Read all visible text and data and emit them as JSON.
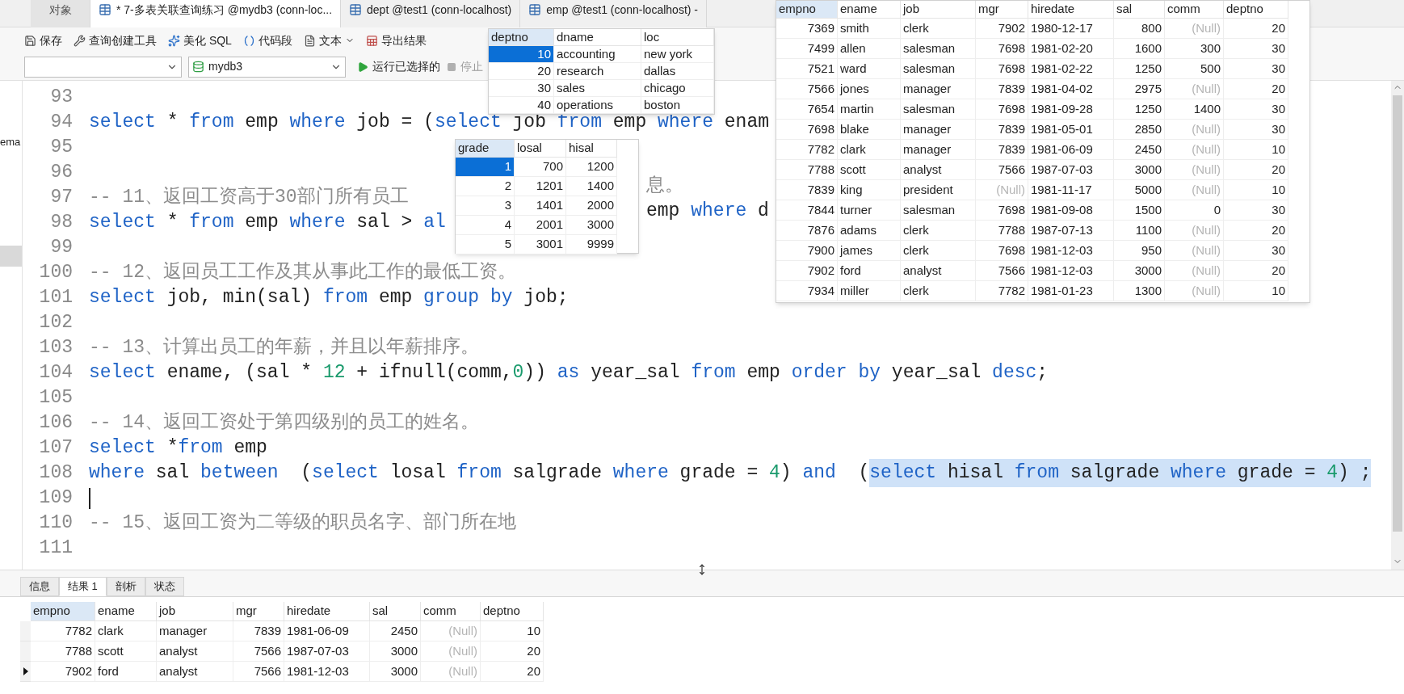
{
  "tabs": [
    {
      "label": "对象",
      "selected": false,
      "kind": "objects"
    },
    {
      "label": "* 7-多表关联查询练习 @mydb3 (conn-loc...",
      "selected": true,
      "kind": "query"
    },
    {
      "label": "dept @test1 (conn-localhost)",
      "selected": false,
      "kind": "table"
    },
    {
      "label": "emp @test1 (conn-localhost) -",
      "selected": false,
      "kind": "table"
    }
  ],
  "toolbar": [
    {
      "label": "保存",
      "kind": "save"
    },
    {
      "label": "查询创建工具",
      "kind": "builder"
    },
    {
      "label": "美化 SQL",
      "kind": "beautify"
    },
    {
      "label": "代码段",
      "kind": "snippet"
    },
    {
      "label": "文本",
      "kind": "text"
    },
    {
      "label": "导出结果",
      "kind": "export"
    }
  ],
  "run_bar": {
    "database": "mydb3",
    "run_button": "运行已选择的",
    "stop_button": {
      "label": "停止",
      "disabled": true
    }
  },
  "sidebar": {
    "text": "ema"
  },
  "editor": {
    "lines": [
      {
        "number": "93"
      },
      {
        "number": "94",
        "parts": [
          {
            "kind": "text",
            "selected": false,
            "tokens": [
              {
                "text": "select",
                "kind": "keyword"
              },
              {
                "text": " * ",
                "kind": "plain"
              },
              {
                "text": "from",
                "kind": "keyword"
              },
              {
                "text": " emp ",
                "kind": "plain"
              },
              {
                "text": "where",
                "kind": "keyword"
              },
              {
                "text": " job = (",
                "kind": "plain"
              },
              {
                "text": "select",
                "kind": "keyword"
              },
              {
                "text": " job ",
                "kind": "plain"
              },
              {
                "text": "from",
                "kind": "keyword"
              },
              {
                "text": " emp ",
                "kind": "plain"
              },
              {
                "text": "where",
                "kind": "keyword"
              },
              {
                "text": " enam",
                "kind": "plain"
              }
            ]
          }
        ]
      },
      {
        "number": "95"
      },
      {
        "number": "96"
      },
      {
        "number": "97",
        "parts": [
          {
            "kind": "text",
            "selected": false,
            "tokens": [
              {
                "text": "-- 11、返回工资高于30部门所有员工",
                "kind": "comment"
              }
            ]
          },
          {
            "kind": "covered"
          },
          {
            "kind": "text",
            "selected": false,
            "tokens": [
              {
                "text": "息。",
                "kind": "comment"
              }
            ]
          }
        ]
      },
      {
        "number": "98",
        "parts": [
          {
            "kind": "text",
            "selected": false,
            "tokens": [
              {
                "text": "select",
                "kind": "keyword"
              },
              {
                "text": " * ",
                "kind": "plain"
              },
              {
                "text": "from",
                "kind": "keyword"
              },
              {
                "text": " emp ",
                "kind": "plain"
              },
              {
                "text": "where",
                "kind": "keyword"
              },
              {
                "text": " sal > ",
                "kind": "plain"
              },
              {
                "text": "al",
                "kind": "keyword"
              }
            ]
          },
          {
            "kind": "covered"
          },
          {
            "kind": "text",
            "selected": false,
            "tokens": [
              {
                "text": "emp ",
                "kind": "plain"
              },
              {
                "text": "where",
                "kind": "keyword"
              },
              {
                "text": " d",
                "kind": "plain"
              }
            ]
          }
        ]
      },
      {
        "number": "99"
      },
      {
        "number": "100",
        "parts": [
          {
            "kind": "text",
            "selected": false,
            "tokens": [
              {
                "text": "-- 12、返回员工工作及其从事此工作的最低工资。",
                "kind": "comment"
              }
            ]
          }
        ]
      },
      {
        "number": "101",
        "parts": [
          {
            "kind": "text",
            "selected": false,
            "tokens": [
              {
                "text": "select",
                "kind": "keyword"
              },
              {
                "text": " job, min(sal) ",
                "kind": "plain"
              },
              {
                "text": "from",
                "kind": "keyword"
              },
              {
                "text": " emp ",
                "kind": "plain"
              },
              {
                "text": "group by",
                "kind": "keyword"
              },
              {
                "text": " job;",
                "kind": "plain"
              }
            ]
          }
        ]
      },
      {
        "number": "102"
      },
      {
        "number": "103",
        "parts": [
          {
            "kind": "text",
            "selected": false,
            "tokens": [
              {
                "text": "-- 13、计算出员工的年薪，并且以年薪排序。",
                "kind": "comment"
              }
            ]
          }
        ]
      },
      {
        "number": "104",
        "parts": [
          {
            "kind": "text",
            "selected": false,
            "tokens": [
              {
                "text": "select",
                "kind": "keyword"
              },
              {
                "text": " ename, (sal * ",
                "kind": "plain"
              },
              {
                "text": "12",
                "kind": "number"
              },
              {
                "text": " + ifnull(comm,",
                "kind": "plain"
              },
              {
                "text": "0",
                "kind": "number"
              },
              {
                "text": ")) ",
                "kind": "plain"
              },
              {
                "text": "as",
                "kind": "keyword"
              },
              {
                "text": " year_sal ",
                "kind": "plain"
              },
              {
                "text": "from",
                "kind": "keyword"
              },
              {
                "text": " emp ",
                "kind": "plain"
              },
              {
                "text": "order by",
                "kind": "keyword"
              },
              {
                "text": " year_sal ",
                "kind": "plain"
              },
              {
                "text": "desc",
                "kind": "keyword"
              },
              {
                "text": ";",
                "kind": "plain"
              }
            ]
          }
        ]
      },
      {
        "number": "105"
      },
      {
        "number": "106",
        "parts": [
          {
            "kind": "text",
            "selected": false,
            "tokens": [
              {
                "text": "-- 14、返回工资处于第四级别的员工的姓名。",
                "kind": "comment"
              }
            ]
          }
        ]
      },
      {
        "number": "107",
        "parts": [
          {
            "kind": "text",
            "selected": false,
            "tokens": [
              {
                "text": "select",
                "kind": "keyword"
              },
              {
                "text": " *",
                "kind": "plain"
              },
              {
                "text": "from",
                "kind": "keyword"
              },
              {
                "text": " emp",
                "kind": "plain"
              }
            ]
          }
        ]
      },
      {
        "number": "108",
        "parts": [
          {
            "kind": "text",
            "selected": false,
            "tokens": [
              {
                "text": "where",
                "kind": "keyword"
              },
              {
                "text": " sal ",
                "kind": "plain"
              },
              {
                "text": "between",
                "kind": "keyword"
              },
              {
                "text": "  (",
                "kind": "plain"
              },
              {
                "text": "select",
                "kind": "keyword"
              },
              {
                "text": " losal ",
                "kind": "plain"
              },
              {
                "text": "from",
                "kind": "keyword"
              },
              {
                "text": " salgrade ",
                "kind": "plain"
              },
              {
                "text": "where",
                "kind": "keyword"
              },
              {
                "text": " grade = ",
                "kind": "plain"
              },
              {
                "text": "4",
                "kind": "number"
              },
              {
                "text": ") ",
                "kind": "plain"
              },
              {
                "text": "and",
                "kind": "keyword"
              },
              {
                "text": "  (",
                "kind": "plain"
              }
            ]
          },
          {
            "kind": "text",
            "selected": true,
            "tokens": [
              {
                "text": "select",
                "kind": "keyword"
              },
              {
                "text": " hisal ",
                "kind": "plain"
              },
              {
                "text": "from",
                "kind": "keyword"
              },
              {
                "text": " salgrade ",
                "kind": "plain"
              },
              {
                "text": "where",
                "kind": "keyword"
              },
              {
                "text": " grade = ",
                "kind": "plain"
              },
              {
                "text": "4",
                "kind": "number"
              },
              {
                "text": ") ;",
                "kind": "plain"
              }
            ]
          }
        ]
      },
      {
        "number": "109",
        "cursor": true
      },
      {
        "number": "110",
        "parts": [
          {
            "kind": "text",
            "selected": false,
            "tokens": [
              {
                "text": "-- 15、返回工资为二等级的职员名字、部门所在地",
                "kind": "comment"
              }
            ]
          }
        ]
      },
      {
        "number": "111"
      }
    ]
  },
  "dept_popup": {
    "columns": [
      {
        "label": "deptno",
        "kind": "number"
      },
      {
        "label": "dname",
        "kind": "text"
      },
      {
        "label": "loc",
        "kind": "text"
      }
    ],
    "rows": [
      {
        "selected": true,
        "cells": [
          "10",
          "accounting",
          "new york"
        ]
      },
      {
        "selected": false,
        "cells": [
          "20",
          "research",
          "dallas"
        ]
      },
      {
        "selected": false,
        "cells": [
          "30",
          "sales",
          "chicago"
        ]
      },
      {
        "selected": false,
        "cells": [
          "40",
          "operations",
          "boston"
        ]
      }
    ]
  },
  "grade_popup": {
    "columns": [
      {
        "label": "grade",
        "kind": "number"
      },
      {
        "label": "losal",
        "kind": "number"
      },
      {
        "label": "hisal",
        "kind": "number"
      }
    ],
    "rows": [
      {
        "selected": true,
        "cells": [
          "1",
          "700",
          "1200"
        ]
      },
      {
        "selected": false,
        "cells": [
          "2",
          "1201",
          "1400"
        ]
      },
      {
        "selected": false,
        "cells": [
          "3",
          "1401",
          "2000"
        ]
      },
      {
        "selected": false,
        "cells": [
          "4",
          "2001",
          "3000"
        ]
      },
      {
        "selected": false,
        "cells": [
          "5",
          "3001",
          "9999"
        ]
      }
    ]
  },
  "emp_popup": {
    "columns": [
      {
        "label": "empno",
        "kind": "number"
      },
      {
        "label": "ename",
        "kind": "text"
      },
      {
        "label": "job",
        "kind": "text"
      },
      {
        "label": "mgr",
        "kind": "number"
      },
      {
        "label": "hiredate",
        "kind": "text"
      },
      {
        "label": "sal",
        "kind": "number"
      },
      {
        "label": "comm",
        "kind": "number"
      },
      {
        "label": "deptno",
        "kind": "number"
      }
    ],
    "rows": [
      {
        "cells": [
          "7369",
          "smith",
          "clerk",
          "7902",
          "1980-12-17",
          "800",
          {
            "text": "(Null)",
            "kind": "null"
          },
          "20"
        ]
      },
      {
        "cells": [
          "7499",
          "allen",
          "salesman",
          "7698",
          "1981-02-20",
          "1600",
          "300",
          "30"
        ]
      },
      {
        "cells": [
          "7521",
          "ward",
          "salesman",
          "7698",
          "1981-02-22",
          "1250",
          "500",
          "30"
        ]
      },
      {
        "cells": [
          "7566",
          "jones",
          "manager",
          "7839",
          "1981-04-02",
          "2975",
          {
            "text": "(Null)",
            "kind": "null"
          },
          "20"
        ]
      },
      {
        "cells": [
          "7654",
          "martin",
          "salesman",
          "7698",
          "1981-09-28",
          "1250",
          "1400",
          "30"
        ]
      },
      {
        "cells": [
          "7698",
          "blake",
          "manager",
          "7839",
          "1981-05-01",
          "2850",
          {
            "text": "(Null)",
            "kind": "null"
          },
          "30"
        ]
      },
      {
        "cells": [
          "7782",
          "clark",
          "manager",
          "7839",
          "1981-06-09",
          "2450",
          {
            "text": "(Null)",
            "kind": "null"
          },
          "10"
        ]
      },
      {
        "cells": [
          "7788",
          "scott",
          "analyst",
          "7566",
          "1987-07-03",
          "3000",
          {
            "text": "(Null)",
            "kind": "null"
          },
          "20"
        ]
      },
      {
        "cells": [
          "7839",
          "king",
          "president",
          {
            "text": "(Null)",
            "kind": "null"
          },
          "1981-11-17",
          "5000",
          {
            "text": "(Null)",
            "kind": "null"
          },
          "10"
        ]
      },
      {
        "cells": [
          "7844",
          "turner",
          "salesman",
          "7698",
          "1981-09-08",
          "1500",
          "0",
          "30"
        ]
      },
      {
        "cells": [
          "7876",
          "adams",
          "clerk",
          "7788",
          "1987-07-13",
          "1100",
          {
            "text": "(Null)",
            "kind": "null"
          },
          "20"
        ]
      },
      {
        "cells": [
          "7900",
          "james",
          "clerk",
          "7698",
          "1981-12-03",
          "950",
          {
            "text": "(Null)",
            "kind": "null"
          },
          "30"
        ]
      },
      {
        "cells": [
          "7902",
          "ford",
          "analyst",
          "7566",
          "1981-12-03",
          "3000",
          {
            "text": "(Null)",
            "kind": "null"
          },
          "20"
        ]
      },
      {
        "cells": [
          "7934",
          "miller",
          "clerk",
          "7782",
          "1981-01-23",
          "1300",
          {
            "text": "(Null)",
            "kind": "null"
          },
          "10"
        ]
      }
    ]
  },
  "result_tabs": [
    {
      "label": "信息",
      "selected": false
    },
    {
      "label": "结果 1",
      "selected": true
    },
    {
      "label": "剖析",
      "selected": false
    },
    {
      "label": "状态",
      "selected": false
    }
  ],
  "result_table": {
    "columns": [
      {
        "label": "empno",
        "kind": "number"
      },
      {
        "label": "ename",
        "kind": "text"
      },
      {
        "label": "job",
        "kind": "text"
      },
      {
        "label": "mgr",
        "kind": "number"
      },
      {
        "label": "hiredate",
        "kind": "text"
      },
      {
        "label": "sal",
        "kind": "number"
      },
      {
        "label": "comm",
        "kind": "number"
      },
      {
        "label": "deptno",
        "kind": "number"
      }
    ],
    "rows": [
      {
        "current": false,
        "cells": [
          "7782",
          "clark",
          "manager",
          "7839",
          "1981-06-09",
          "2450",
          {
            "text": "(Null)",
            "kind": "null"
          },
          "10"
        ]
      },
      {
        "current": false,
        "cells": [
          "7788",
          "scott",
          "analyst",
          "7566",
          "1987-07-03",
          "3000",
          {
            "text": "(Null)",
            "kind": "null"
          },
          "20"
        ]
      },
      {
        "current": true,
        "cells": [
          "7902",
          "ford",
          "analyst",
          "7566",
          "1981-12-03",
          "3000",
          {
            "text": "(Null)",
            "kind": "null"
          },
          "20"
        ]
      }
    ]
  }
}
